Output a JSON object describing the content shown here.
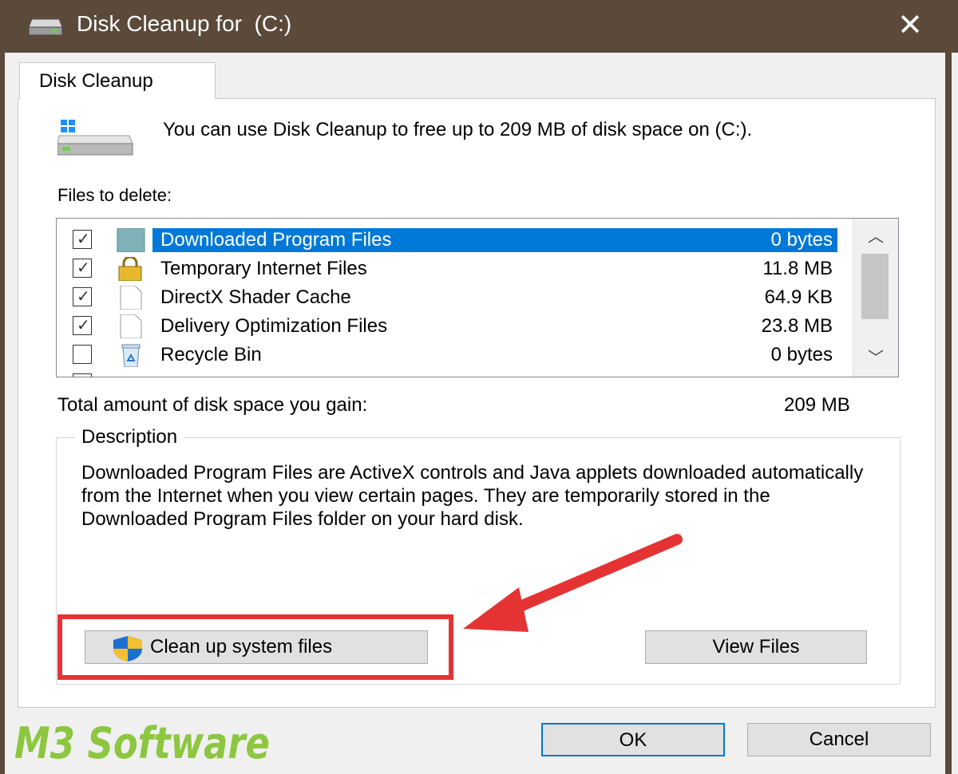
{
  "window": {
    "title": "Disk Cleanup for  (C:)",
    "close_glyph": "✕"
  },
  "tab": {
    "label": "Disk Cleanup"
  },
  "intro": {
    "text": "You can use Disk Cleanup to free up to 209 MB of disk space on  (C:)."
  },
  "files": {
    "label": "Files to delete:",
    "items": [
      {
        "name": "Downloaded Program Files",
        "size": "0 bytes",
        "checked": true,
        "selected": true,
        "icon": "folder-icon"
      },
      {
        "name": "Temporary Internet Files",
        "size": "11.8 MB",
        "checked": true,
        "selected": false,
        "icon": "lock-icon"
      },
      {
        "name": "DirectX Shader Cache",
        "size": "64.9 KB",
        "checked": true,
        "selected": false,
        "icon": "file-icon"
      },
      {
        "name": "Delivery Optimization Files",
        "size": "23.8 MB",
        "checked": true,
        "selected": false,
        "icon": "file-icon"
      },
      {
        "name": "Recycle Bin",
        "size": "0 bytes",
        "checked": false,
        "selected": false,
        "icon": "recycle-bin-icon"
      }
    ]
  },
  "total": {
    "label": "Total amount of disk space you gain:",
    "value": "209 MB"
  },
  "description": {
    "legend": "Description",
    "text": "Downloaded Program Files are ActiveX controls and Java applets downloaded automatically from the Internet when you view certain pages. They are temporarily stored in the Downloaded Program Files folder on your hard disk."
  },
  "buttons": {
    "clean_up": "Clean up system files",
    "view_files": "View Files",
    "ok": "OK",
    "cancel": "Cancel"
  },
  "watermark": {
    "text": "M3 Software"
  },
  "colors": {
    "titlebar": "#5b4a3a",
    "selection": "#0078d7",
    "highlight": "#e53333",
    "watermark": "#8dc63f"
  }
}
